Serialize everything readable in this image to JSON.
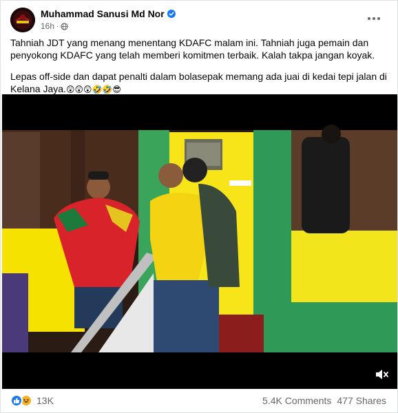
{
  "author": {
    "name": "Muhammad Sanusi Md Nor",
    "verified_icon": "verified-badge-icon",
    "time": "16h",
    "privacy_icon": "globe-icon"
  },
  "post": {
    "paragraph1": "Tahniah JDT yang menang menentang KDAFC malam ini. Tahniah juga pemain dan penyokong KDAFC yang telah memberi komitmen terbaik. Kalah takpa jangan koyak.",
    "paragraph2": "Lepas off-side dan dapat penalti dalam bolasepak memang ada juai di kedai tepi jalan di Kelana Jaya.",
    "emojis": "😲😲😲🤣🤣😎"
  },
  "video": {
    "mute_icon": "speaker-muted-icon"
  },
  "footer": {
    "reaction_count": "13K",
    "comments": "5.4K Comments",
    "shares": "477 Shares"
  },
  "colors": {
    "brand_blue": "#1877f2",
    "secondary_text": "#65676b"
  }
}
